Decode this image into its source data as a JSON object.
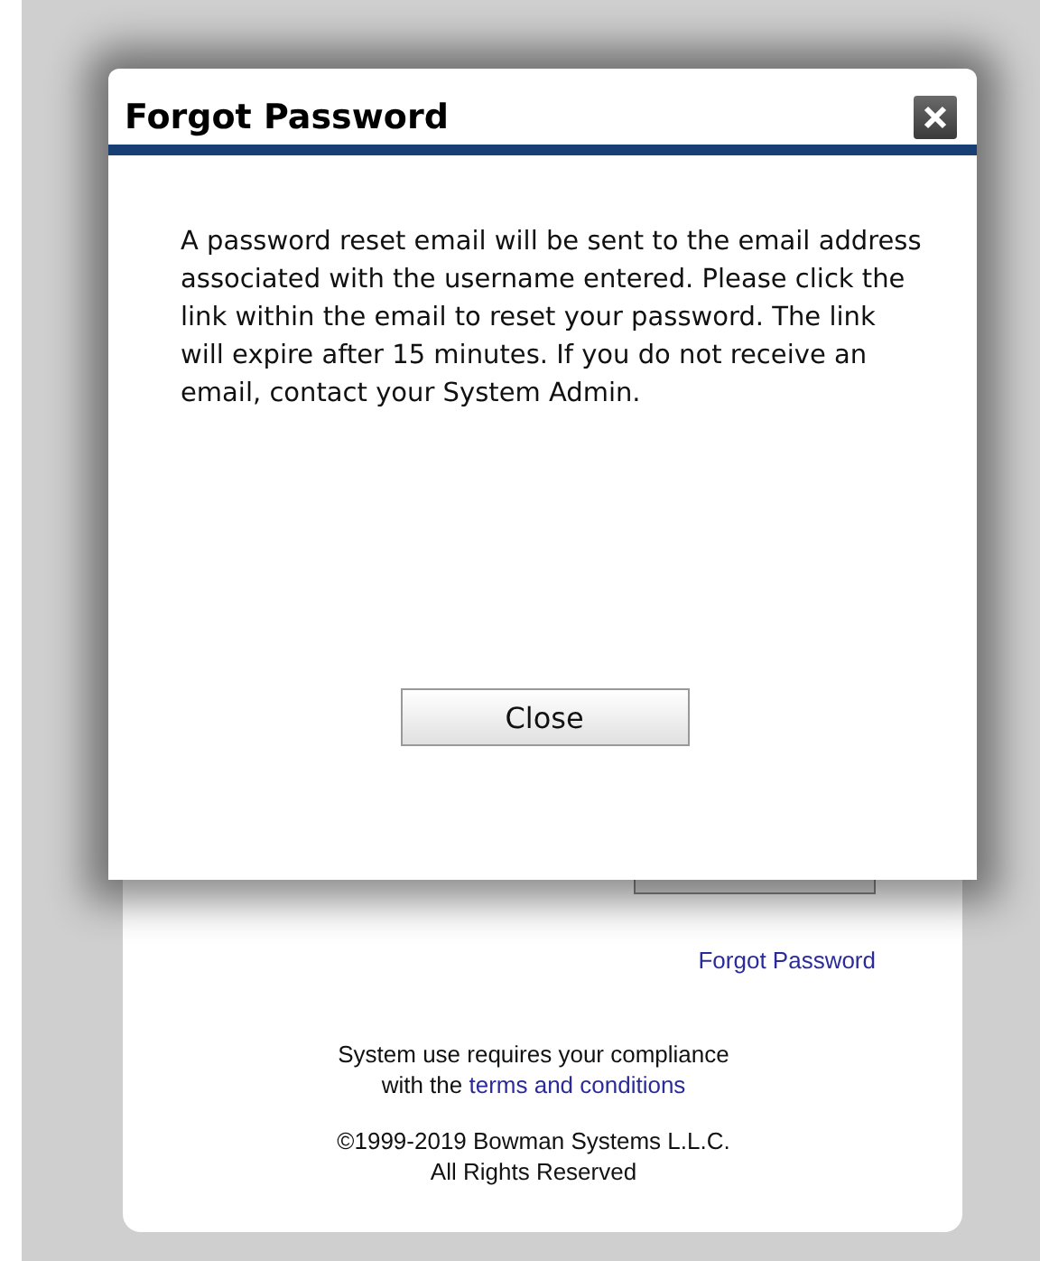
{
  "dialog": {
    "title": "Forgot Password",
    "message": "A password reset email will be sent to the email address associated with the username entered. Please click the link within the email to reset your password. The link will expire after 15 minutes. If you do not receive an email, contact your System Admin.",
    "button": "Close"
  },
  "login_card": {
    "forgot_link": "Forgot Password",
    "compliance_text": "System use requires your compliance with the",
    "terms_link": "terms and conditions",
    "copyright": "©1999-2019 Bowman Systems L.L.C.",
    "rights": "All Rights Reserved"
  }
}
